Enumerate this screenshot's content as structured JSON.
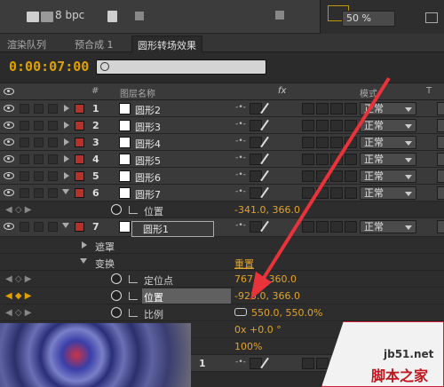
{
  "toolbar": {
    "bpc_label": "8 bpc"
  },
  "viewer": {
    "zoom": "50 %"
  },
  "tabs": [
    {
      "label": "渲染队列",
      "active": false
    },
    {
      "label": "预合成 1",
      "active": false
    },
    {
      "label": "圆形转场效果",
      "active": true
    }
  ],
  "timeline": {
    "timecode": "0:00:07:00",
    "search_placeholder": ""
  },
  "columns": {
    "hash": "#",
    "layer_name": "图层名称",
    "fx": "fx",
    "mode": "模式",
    "t": "T"
  },
  "layers": [
    {
      "num": "1",
      "name": "圆形2",
      "mode": "正常",
      "expanded": false
    },
    {
      "num": "2",
      "name": "圆形3",
      "mode": "正常",
      "expanded": false
    },
    {
      "num": "3",
      "name": "圆形4",
      "mode": "正常",
      "expanded": false
    },
    {
      "num": "4",
      "name": "圆形5",
      "mode": "正常",
      "expanded": false
    },
    {
      "num": "5",
      "name": "圆形6",
      "mode": "正常",
      "expanded": false
    },
    {
      "num": "6",
      "name": "圆形7",
      "mode": "正常",
      "expanded": true
    }
  ],
  "layer6_prop": {
    "name": "位置",
    "value": "-341.0, 366.0"
  },
  "layer7": {
    "num": "7",
    "name": "圆形1",
    "mode": "正常"
  },
  "groups": {
    "mask": "遮罩",
    "transform": "变换",
    "reset": "重置"
  },
  "transform_props": [
    {
      "name": "定位点",
      "value": "767.0, 360.0"
    },
    {
      "name": "位置",
      "value": "-923.0, 366.0"
    },
    {
      "name": "比例",
      "value": "550.0, 550.0%"
    }
  ],
  "rotation_value": "0x +0.0 °",
  "opacity_value": "100%",
  "precomp_num": "1",
  "watermark": {
    "site": "jb51.net",
    "name": "脚本之家"
  },
  "colors": {
    "timecode": "#e0a000",
    "label_red": "#b5312b",
    "value_orange": "#e2a32a",
    "arrow": "#e8333a"
  }
}
